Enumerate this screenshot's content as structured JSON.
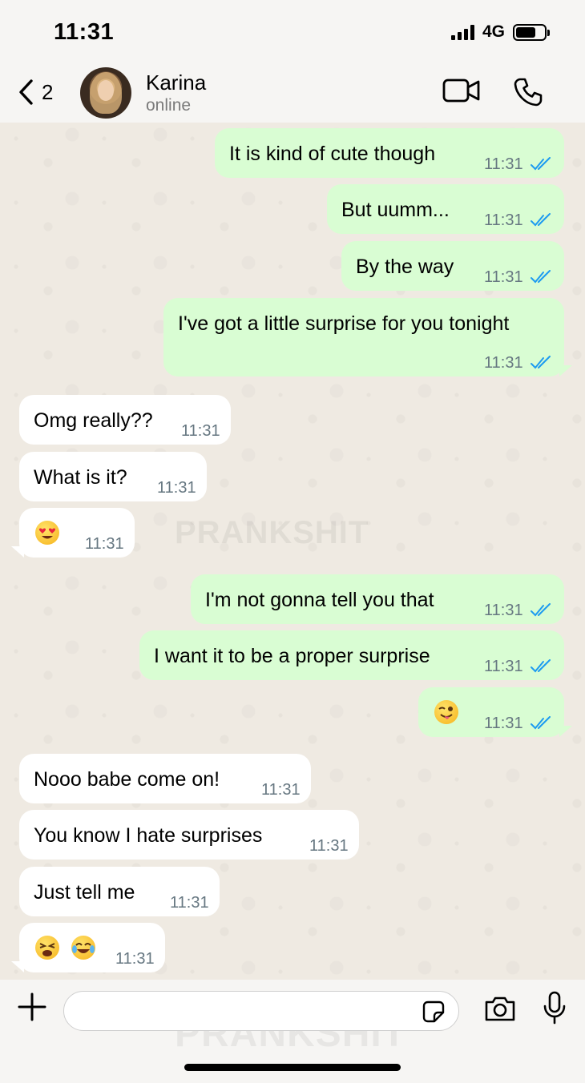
{
  "status_bar": {
    "time": "11:31",
    "network": "4G"
  },
  "watermark": "PRANKSHIT",
  "header": {
    "back_count": "2",
    "contact_name": "Karina",
    "contact_status": "online"
  },
  "messages": [
    {
      "dir": "out",
      "text": "It is kind of cute though",
      "time": "11:31"
    },
    {
      "dir": "out",
      "text": "But uumm...",
      "time": "11:31"
    },
    {
      "dir": "out",
      "text": "By the way",
      "time": "11:31"
    },
    {
      "dir": "out",
      "text": "I've got a little surprise for you tonight",
      "time": "11:31"
    },
    {
      "dir": "in",
      "text": "Omg really??",
      "time": "11:31"
    },
    {
      "dir": "in",
      "text": "What is it?",
      "time": "11:31"
    },
    {
      "dir": "in",
      "text": "",
      "emoji": [
        "heart-eyes-emoji"
      ],
      "time": "11:31"
    },
    {
      "dir": "out",
      "text": "I'm not gonna tell you that",
      "time": "11:31"
    },
    {
      "dir": "out",
      "text": "I want it to be a proper surprise",
      "time": "11:31"
    },
    {
      "dir": "out",
      "text": "",
      "emoji": [
        "winking-tongue-emoji"
      ],
      "time": "11:31"
    },
    {
      "dir": "in",
      "text": "Nooo babe come on!",
      "time": "11:31"
    },
    {
      "dir": "in",
      "text": "You know I hate surprises",
      "time": "11:31"
    },
    {
      "dir": "in",
      "text": "Just tell me",
      "time": "11:31"
    },
    {
      "dir": "in",
      "text": "",
      "emoji": [
        "weary-face-emoji",
        "tears-of-joy-emoji"
      ],
      "time": "11:31"
    }
  ],
  "composer": {
    "value": "",
    "placeholder": ""
  },
  "colors": {
    "outgoing": "#d9fdd3",
    "incoming": "#ffffff",
    "read_ticks": "#1d9bf0",
    "chat_bg": "#efeae2"
  }
}
